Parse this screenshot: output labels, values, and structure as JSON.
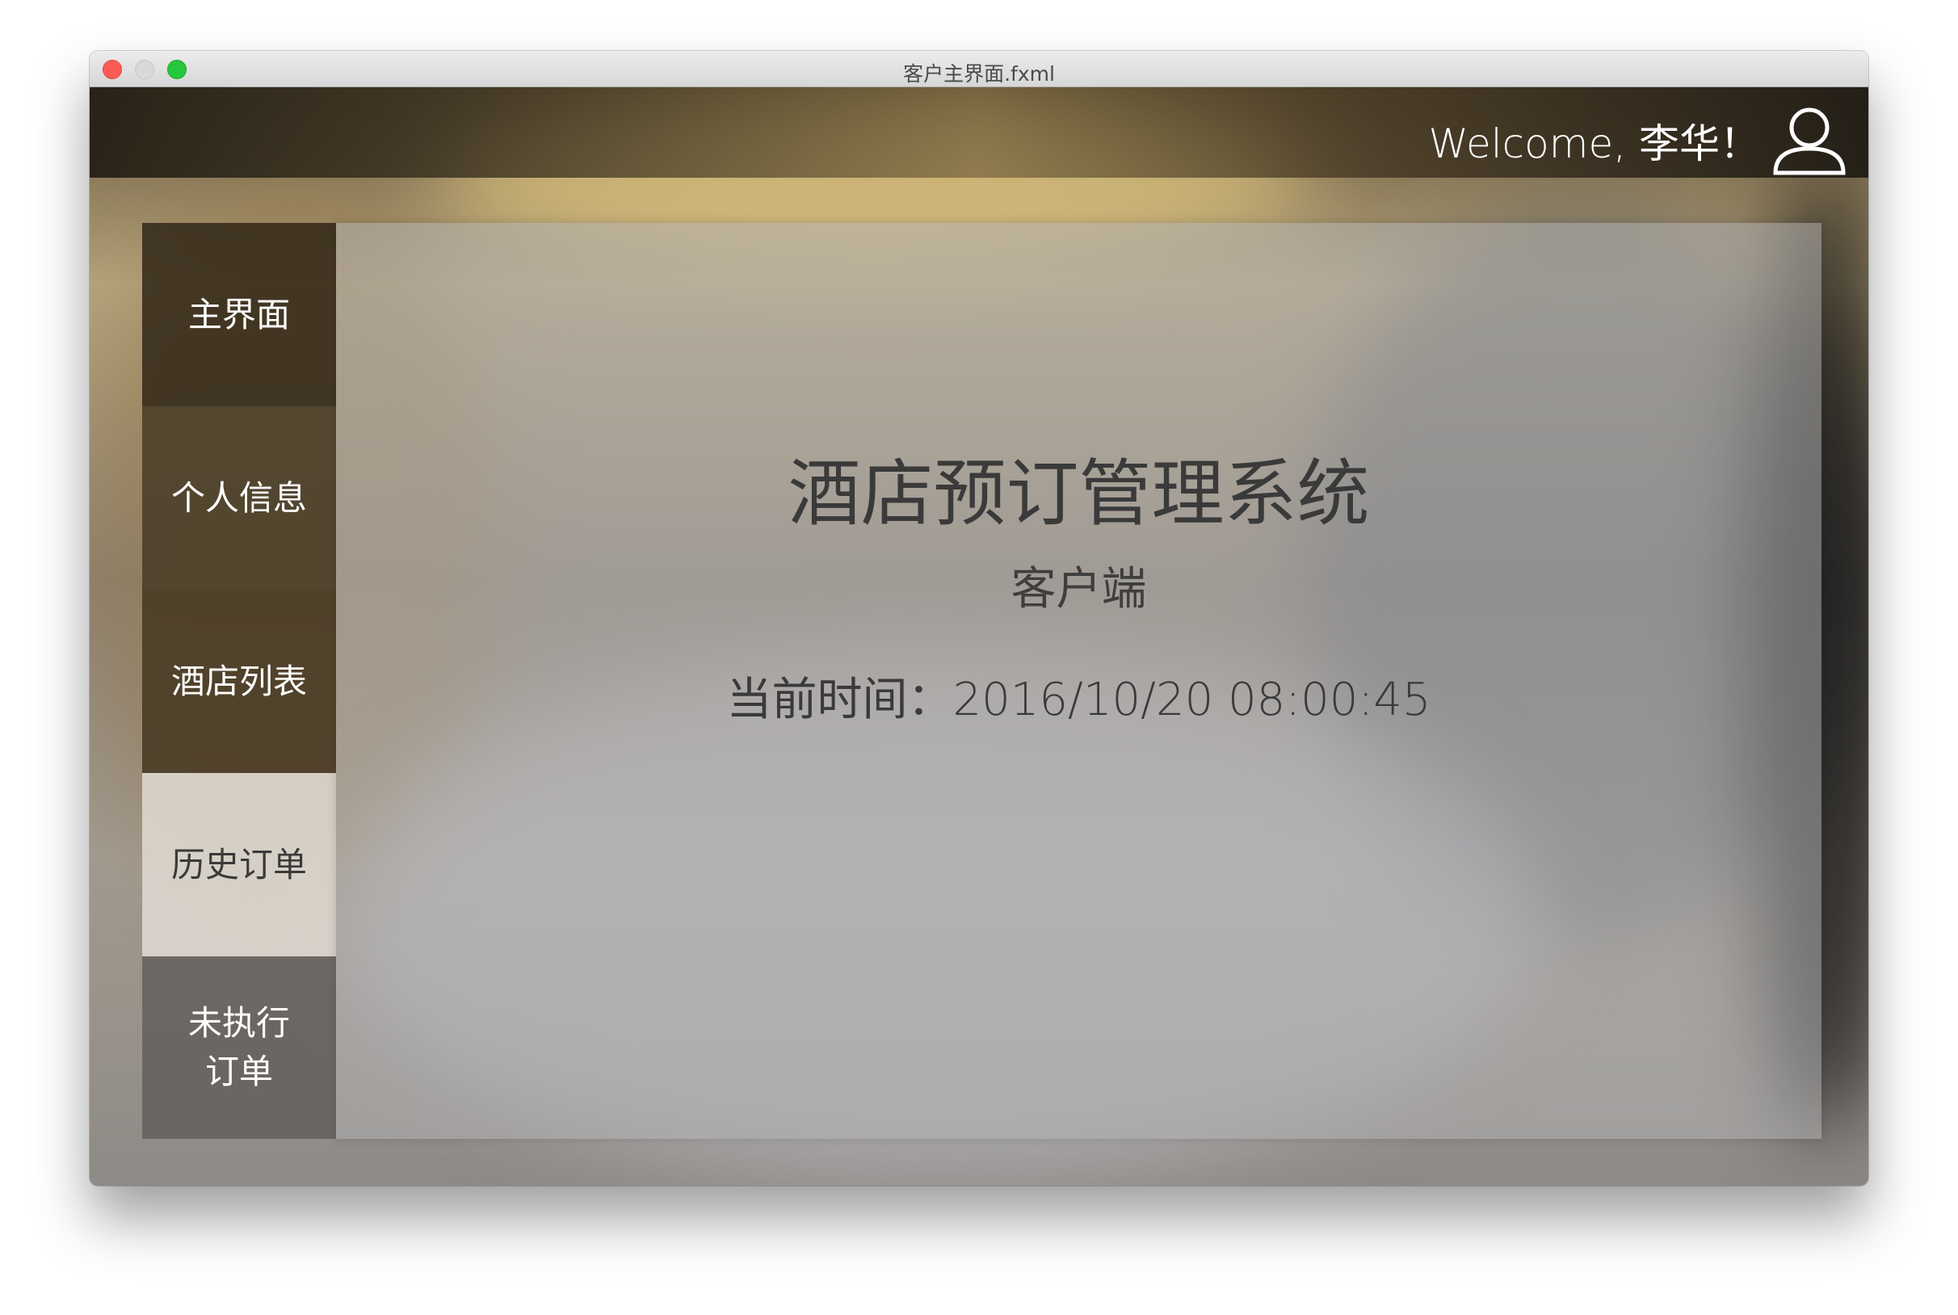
{
  "window": {
    "title": "客户主界面.fxml"
  },
  "header": {
    "welcome_text": "Welcome, 李华！",
    "user_icon": "user-icon"
  },
  "sidebar": {
    "items": [
      {
        "label": "主界面"
      },
      {
        "label": "个人信息"
      },
      {
        "label": "酒店列表"
      },
      {
        "label": "历史订单",
        "selected": true
      },
      {
        "label": "未执行\n订单"
      }
    ]
  },
  "main": {
    "title": "酒店预订管理系统",
    "subtitle": "客户端",
    "current_time": "当前时间：2016/10/20 08:00:45"
  },
  "colors": {
    "window_close": "#fd5c56",
    "window_minimize_disabled": "#d9d9d9",
    "window_zoom": "#27c73d",
    "sidebar_dark": "#342a1a",
    "sidebar_selected": "#ded8d0",
    "text_dark": "#3a3a3a"
  }
}
